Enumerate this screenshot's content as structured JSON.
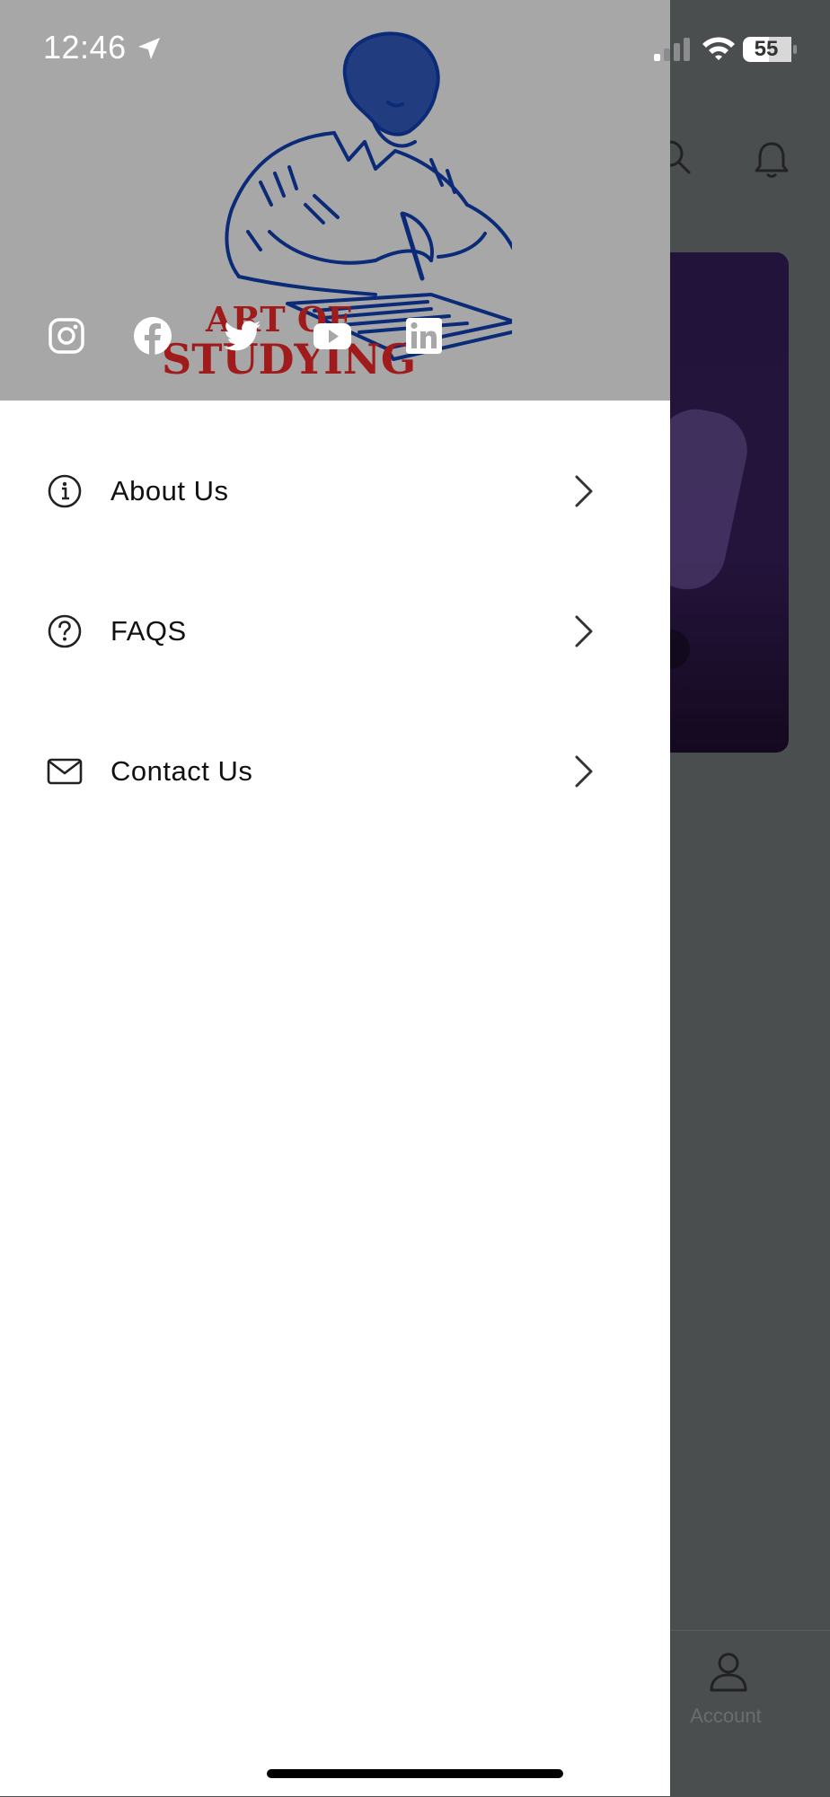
{
  "status_bar": {
    "time": "12:46",
    "battery": "55"
  },
  "drawer": {
    "logo": {
      "line1": "ART OF",
      "line2": "STUDYING"
    },
    "social_icons": [
      "instagram-icon",
      "facebook-icon",
      "twitter-icon",
      "youtube-icon",
      "linkedin-icon"
    ],
    "menu": [
      {
        "label": "About Us",
        "icon": "info-icon"
      },
      {
        "label": "FAQS",
        "icon": "question-icon"
      },
      {
        "label": "Contact Us",
        "icon": "mail-icon"
      }
    ]
  },
  "background": {
    "tab_account_label": "Account"
  },
  "colors": {
    "header_bg": "#a7a7a7",
    "logo_ink": "#0b2a78",
    "logo_text": "#a01b1b",
    "overlay": "#4b4e4f",
    "banner": "#22133a"
  }
}
